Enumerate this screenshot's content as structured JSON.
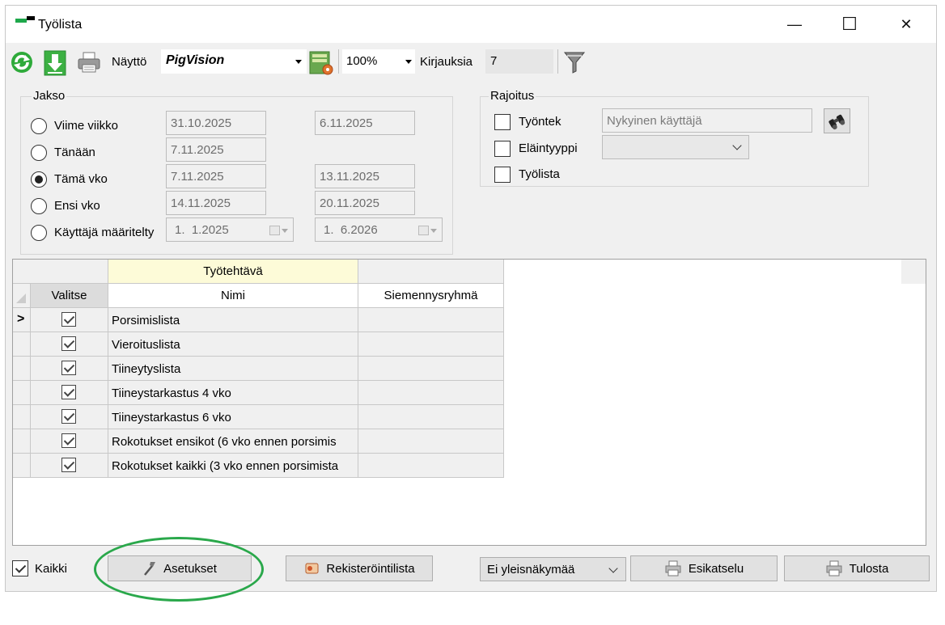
{
  "window": {
    "title": "Työlista",
    "minimize_symbol": "—",
    "maximize_symbol": "☐",
    "close_symbol": "✕"
  },
  "toolbar": {
    "view_label": "Näyttö",
    "view_value": "PigVision",
    "zoom_value": "100%",
    "entries_label": "Kirjauksia",
    "entries_value": "7"
  },
  "period": {
    "title": "Jakso",
    "options": [
      {
        "label": "Viime viikko",
        "from": "31.10.2025",
        "to": "6.11.2025",
        "selected": false
      },
      {
        "label": "Tänään",
        "from": "7.11.2025",
        "to": "",
        "selected": false
      },
      {
        "label": "Tämä vko",
        "from": "7.11.2025",
        "to": "13.11.2025",
        "selected": true
      },
      {
        "label": "Ensi vko",
        "from": "14.11.2025",
        "to": "20.11.2025",
        "selected": false
      },
      {
        "label": "Käyttäjä määritelty",
        "from": "1.  1.2025",
        "to": "1.  6.2026",
        "selected": false
      }
    ]
  },
  "restriction": {
    "title": "Rajoitus",
    "employee_label": "Työntek",
    "employee_placeholder": "Nykyinen käyttäjä",
    "animal_type_label": "Eläintyyppi",
    "worklist_label": "Työlista"
  },
  "grid": {
    "group_header": "Työtehtävä",
    "columns": [
      "Valitse",
      "Nimi",
      "Siemennysryhmä"
    ],
    "current_row_marker": ">",
    "rows": [
      {
        "name": "Porsimislista",
        "group": "",
        "checked": true
      },
      {
        "name": "Vieroituslista",
        "group": "",
        "checked": true
      },
      {
        "name": "Tiineytyslista",
        "group": "",
        "checked": true
      },
      {
        "name": "Tiineystarkastus 4 vko",
        "group": "",
        "checked": true
      },
      {
        "name": "Tiineystarkastus 6 vko",
        "group": "",
        "checked": true
      },
      {
        "name": "Rokotukset ensikot (6 vko ennen porsimis",
        "group": "",
        "checked": true
      },
      {
        "name": "Rokotukset kaikki (3 vko ennen porsimista",
        "group": "",
        "checked": true
      }
    ]
  },
  "footer": {
    "all_label": "Kaikki",
    "settings_label": "Asetukset",
    "registration_label": "Rekisteröintilista",
    "overview_value": "Ei yleisnäkymää",
    "preview_label": "Esikatselu",
    "print_label": "Tulosta"
  },
  "colors": {
    "refresh_green": "#2eaa3a",
    "download_green": "#3cb043",
    "header_yellow": "#fdfbd8",
    "highlight_ellipse": "#2aa84b"
  }
}
